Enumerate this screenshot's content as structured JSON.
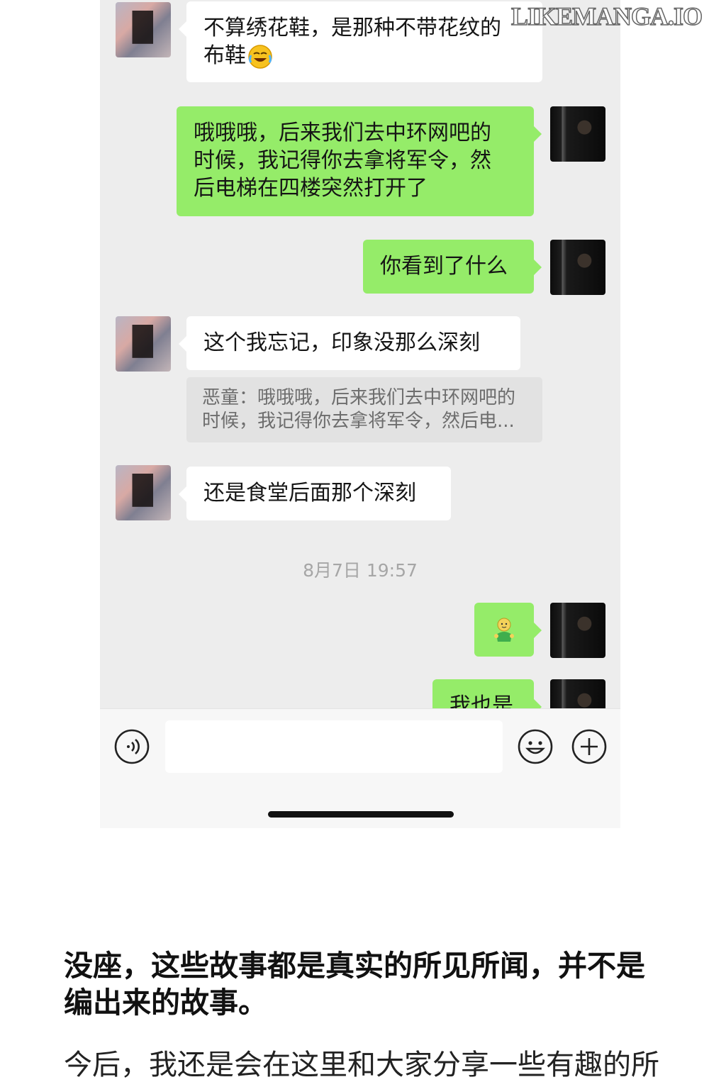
{
  "watermark": "LIKEMANGA.IO",
  "chat": {
    "messages": [
      {
        "side": "in",
        "text": "不算绣花鞋，是那种不带花纹的\n布鞋"
      },
      {
        "side": "out",
        "text": "哦哦哦，后来我们去中环网吧的\n时候，我记得你去拿将军令，然\n后电梯在四楼突然打开了"
      },
      {
        "side": "out",
        "text": "你看到了什么"
      },
      {
        "side": "in",
        "text": "这个我忘记，印象没那么深刻"
      },
      {
        "side": "in",
        "text": "还是食堂后面那个深刻"
      },
      {
        "side": "out",
        "text": "我也是"
      }
    ],
    "quote": "恶童：哦哦哦，后来我们去中环网吧的\n时候，我记得你去拿将军令，然后电...",
    "timestamp": "8月7日 19:57",
    "emoji_names": {
      "laugh_cry": "face-with-tears-of-joy-emoji",
      "sticker": "green-figure-sticker"
    }
  },
  "input_bar": {
    "voice_icon": "voice-icon",
    "emoji_icon": "smiley-icon",
    "plus_icon": "plus-icon",
    "text_value": ""
  },
  "caption": "没座，这些故事都是真实的所见所闻，并不是编出来的故事。",
  "partial_text": "今后，我还是会在这里和大家分享一些有趣的所"
}
